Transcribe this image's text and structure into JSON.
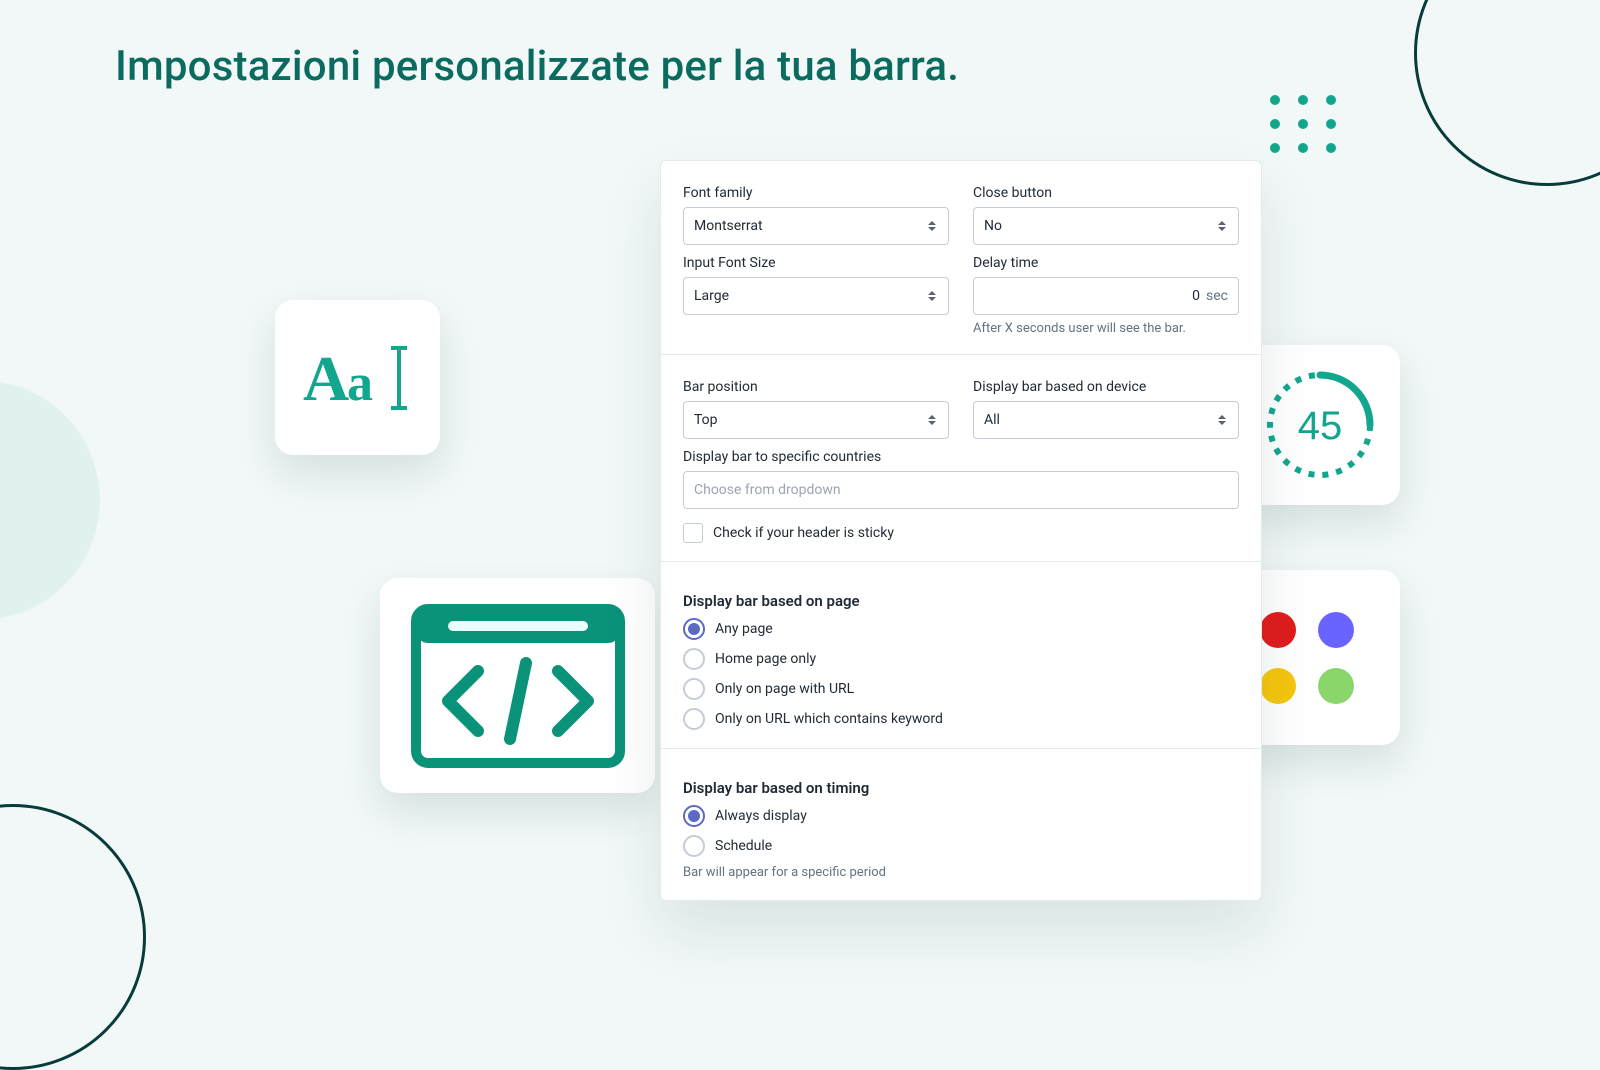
{
  "title": "Impostazioni personalizzate per la tua barra.",
  "colors": {
    "accent": "#0B937A",
    "indigo": "#5C6AC4"
  },
  "panel": {
    "font_family": {
      "label": "Font family",
      "value": "Montserrat"
    },
    "close_button": {
      "label": "Close button",
      "value": "No"
    },
    "input_font_size": {
      "label": "Input Font Size",
      "value": "Large"
    },
    "delay_time": {
      "label": "Delay time",
      "value": "0",
      "suffix": "sec",
      "help": "After X seconds user will see the bar."
    },
    "bar_position": {
      "label": "Bar position",
      "value": "Top"
    },
    "display_device": {
      "label": "Display bar based on device",
      "value": "All"
    },
    "countries": {
      "label": "Display bar to specific countries",
      "placeholder": "Choose from dropdown"
    },
    "sticky_check": {
      "label": "Check if your header is sticky"
    },
    "page_section": {
      "title": "Display bar based on page",
      "options": [
        "Any page",
        "Home page only",
        "Only on page with URL",
        "Only on URL which contains keyword"
      ],
      "selected": 0
    },
    "timing_section": {
      "title": "Display bar based on timing",
      "options": [
        "Always display",
        "Schedule"
      ],
      "selected": 0,
      "cutoff_text": "Bar will appear for a specific period"
    }
  },
  "feature_cards": {
    "aa_text": "Aa",
    "timer_value": "45",
    "swatches": {
      "row1": [
        "#1CA7EC",
        "#E11D1D",
        "#6B63FF"
      ],
      "row2": [
        "#F59BA6",
        "#F6C60E",
        "#8BD66B"
      ]
    }
  }
}
